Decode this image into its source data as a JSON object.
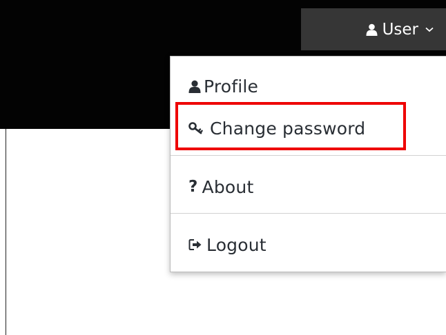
{
  "header": {
    "user_label": "User"
  },
  "menu": {
    "items": [
      {
        "label": "Profile",
        "icon": "user-icon"
      },
      {
        "label": "Change password",
        "icon": "key-icon"
      },
      {
        "label": "About",
        "icon": "question-icon"
      },
      {
        "label": "Logout",
        "icon": "logout-icon"
      }
    ]
  },
  "colors": {
    "topbar": "#030303",
    "user_toggle_bg": "#363636",
    "highlight": "#ee0000",
    "menu_text": "#292e34"
  }
}
